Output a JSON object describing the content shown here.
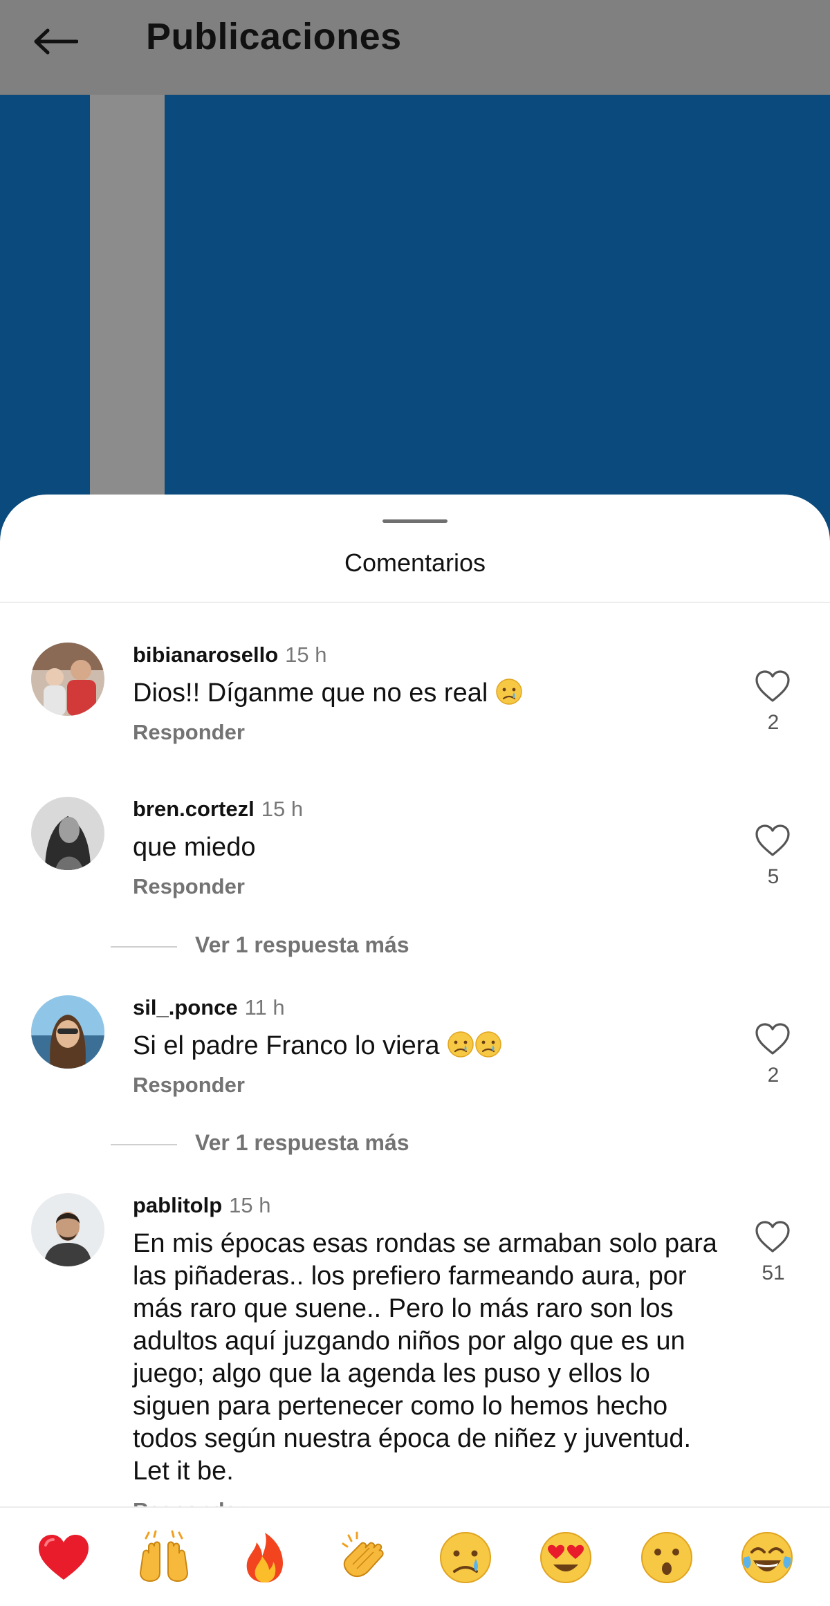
{
  "header": {
    "title": "Publicaciones"
  },
  "sheet": {
    "title": "Comentarios"
  },
  "comments": [
    {
      "username": "bibianarosello",
      "time": "15 h",
      "text": "Dios!! Díganme que no es real",
      "reply_label": "Responder",
      "likes": "2"
    },
    {
      "username": "bren.cortezl",
      "time": "15 h",
      "text": "que miedo",
      "reply_label": "Responder",
      "likes": "5",
      "more_replies": "Ver 1 respuesta más"
    },
    {
      "username": "sil_.ponce",
      "time": "11 h",
      "text": "Si el padre Franco lo viera",
      "reply_label": "Responder",
      "likes": "2",
      "more_replies": "Ver 1 respuesta más"
    },
    {
      "username": "pablitolp",
      "time": "15 h",
      "text": "En mis épocas esas rondas se armaban solo para las piñaderas.. los prefiero farmeando aura, por más raro que suene.. Pero lo más raro son los adultos aquí juzgando niños por algo que es un juego; algo que la agenda les puso y ellos lo siguen para pertenecer como lo hemos hecho todos según nuestra época de niñez y juventud. Let it be.",
      "reply_label": "Responder",
      "likes": "51"
    }
  ],
  "reactions": [
    "red-heart",
    "raising-hands",
    "fire",
    "clapping-hands",
    "crying-face",
    "heart-eyes-face",
    "surprised-face",
    "tears-of-joy-face"
  ],
  "colors": {
    "header_bg": "#808080",
    "post_bg": "#0a4a7c",
    "stripe": "#8c8c8c",
    "muted_text": "#737373"
  }
}
